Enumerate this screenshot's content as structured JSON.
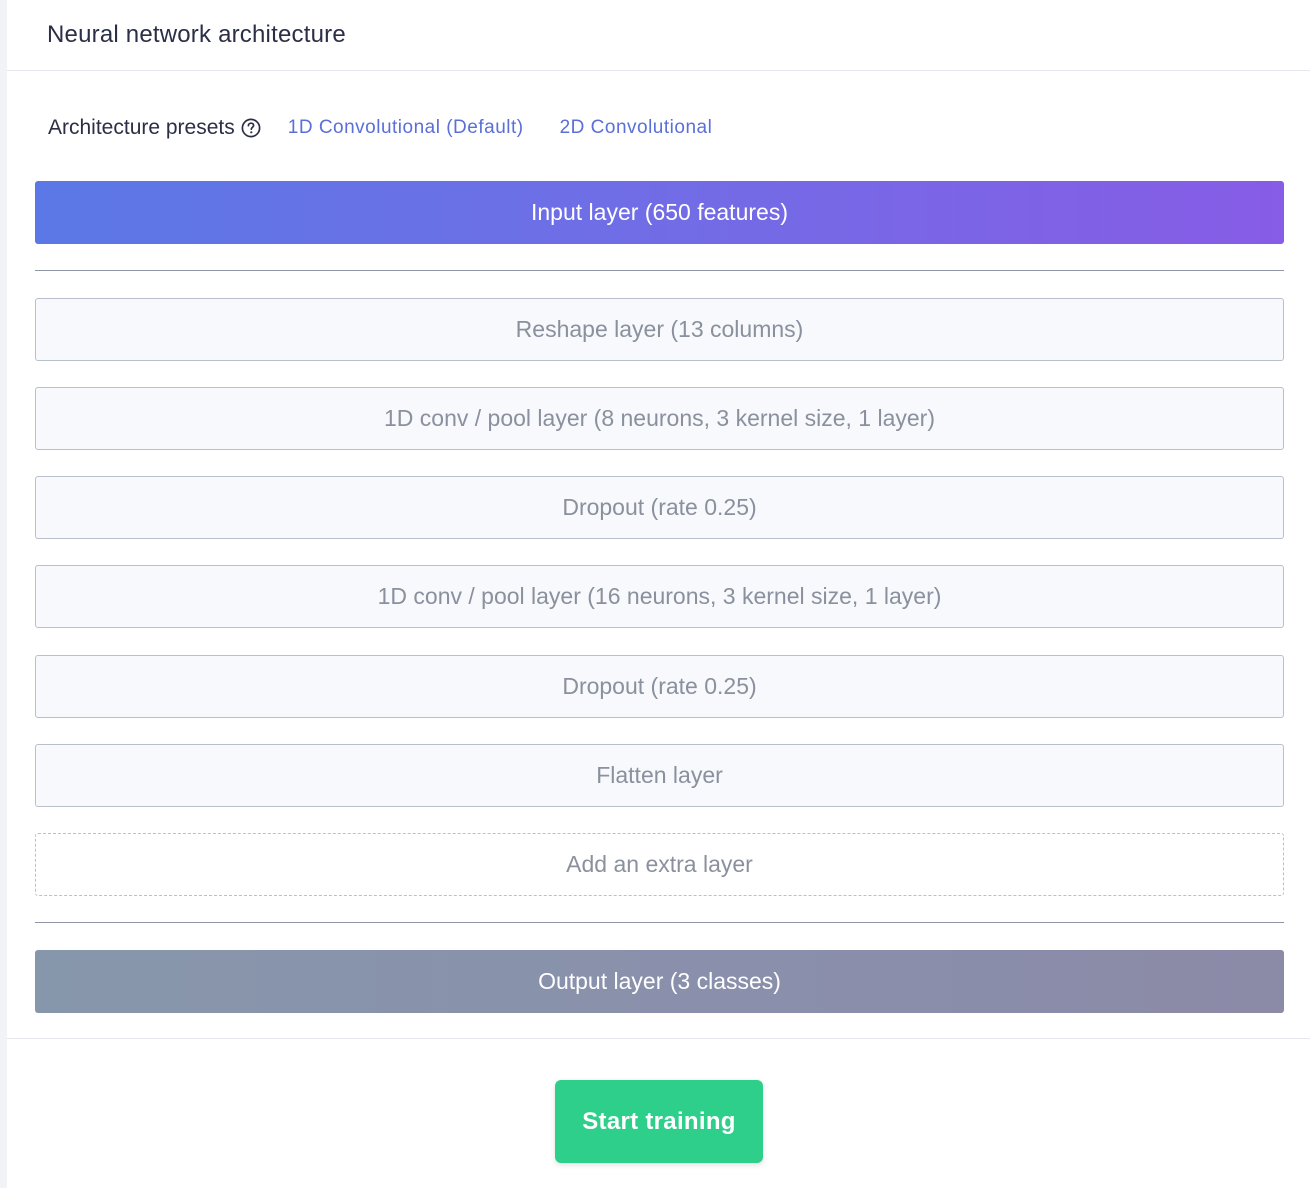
{
  "header": {
    "title": "Neural network architecture"
  },
  "presets": {
    "label": "Architecture presets",
    "help_icon": "question-circle-icon",
    "options": [
      "1D Convolutional (Default)",
      "2D Convolutional"
    ]
  },
  "layers": {
    "input": "Input layer (650 features)",
    "hidden": [
      "Reshape layer (13 columns)",
      "1D conv / pool layer (8 neurons, 3 kernel size, 1 layer)",
      "Dropout (rate 0.25)",
      "1D conv / pool layer (16 neurons, 3 kernel size, 1 layer)",
      "Dropout (rate 0.25)",
      "Flatten layer"
    ],
    "add_extra": "Add an extra layer",
    "output": "Output layer (3 classes)"
  },
  "actions": {
    "start_training": "Start training"
  },
  "colors": {
    "accent_link": "#5a6fd8",
    "input_gradient_start": "#5b78e6",
    "input_gradient_end": "#875ce6",
    "output_layer": "#8a92aa",
    "start_button": "#2ecf8a"
  }
}
